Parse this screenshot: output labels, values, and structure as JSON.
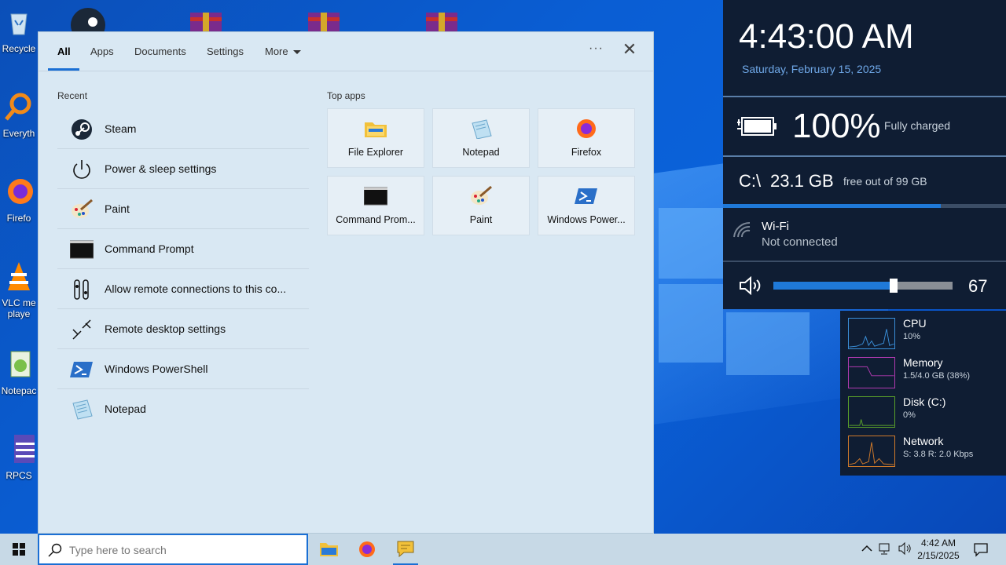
{
  "desktop": {
    "icons": [
      {
        "label": "Recycle"
      },
      {
        "label": "Everyth"
      },
      {
        "label": "Firefo"
      },
      {
        "label": "VLC me"
      },
      {
        "label": "playe"
      },
      {
        "label": "Notepac"
      },
      {
        "label": "RPCS"
      }
    ]
  },
  "search_panel": {
    "tabs": [
      {
        "label": "All"
      },
      {
        "label": "Apps"
      },
      {
        "label": "Documents"
      },
      {
        "label": "Settings"
      },
      {
        "label": "More"
      }
    ],
    "dots_label": "···",
    "close_label": "✕",
    "recent_title": "Recent",
    "recent": [
      {
        "label": "Steam",
        "icon": "steam-icon"
      },
      {
        "label": "Power & sleep settings",
        "icon": "power-icon"
      },
      {
        "label": "Paint",
        "icon": "paint-icon"
      },
      {
        "label": "Command Prompt",
        "icon": "command-prompt-icon"
      },
      {
        "label": "Allow remote connections to this co...",
        "icon": "remote-settings-icon"
      },
      {
        "label": "Remote desktop settings",
        "icon": "remote-desktop-icon"
      },
      {
        "label": "Windows PowerShell",
        "icon": "powershell-icon"
      },
      {
        "label": "Notepad",
        "icon": "notepad-icon"
      }
    ],
    "top_apps_title": "Top apps",
    "top_apps": [
      {
        "label": "File Explorer",
        "icon": "file-explorer-icon"
      },
      {
        "label": "Notepad",
        "icon": "notepad-icon"
      },
      {
        "label": "Firefox",
        "icon": "firefox-icon"
      },
      {
        "label": "Command Prom...",
        "icon": "command-prompt-icon"
      },
      {
        "label": "Paint",
        "icon": "paint-icon"
      },
      {
        "label": "Windows Power...",
        "icon": "powershell-icon"
      }
    ]
  },
  "widget": {
    "time": "4:43:00 AM",
    "date": "Saturday, February 15, 2025",
    "battery_percent": "100%",
    "battery_status": "Fully charged",
    "drive_label": "C:\\",
    "drive_free": "23.1 GB",
    "drive_sub": "free out of 99 GB",
    "drive_used_fraction": 0.77,
    "wifi_name": "Wi-Fi",
    "wifi_status": "Not connected",
    "volume": "67"
  },
  "perf": [
    {
      "name": "CPU",
      "value": "10%",
      "color": "#3a8ed8"
    },
    {
      "name": "Memory",
      "value": "1.5/4.0 GB (38%)",
      "color": "#b03ab0"
    },
    {
      "name": "Disk (C:)",
      "value": "0%",
      "color": "#5aa02a"
    },
    {
      "name": "Network",
      "value": "S: 3.8 R: 2.0 Kbps",
      "color": "#d07a2a"
    }
  ],
  "taskbar": {
    "search_placeholder": "Type here to search",
    "tray_time": "4:42 AM",
    "tray_date": "2/15/2025"
  },
  "colors": {
    "accent": "#1a6fd4",
    "widget_bg": "#0f1d33",
    "date_text": "#6fa8e8"
  }
}
